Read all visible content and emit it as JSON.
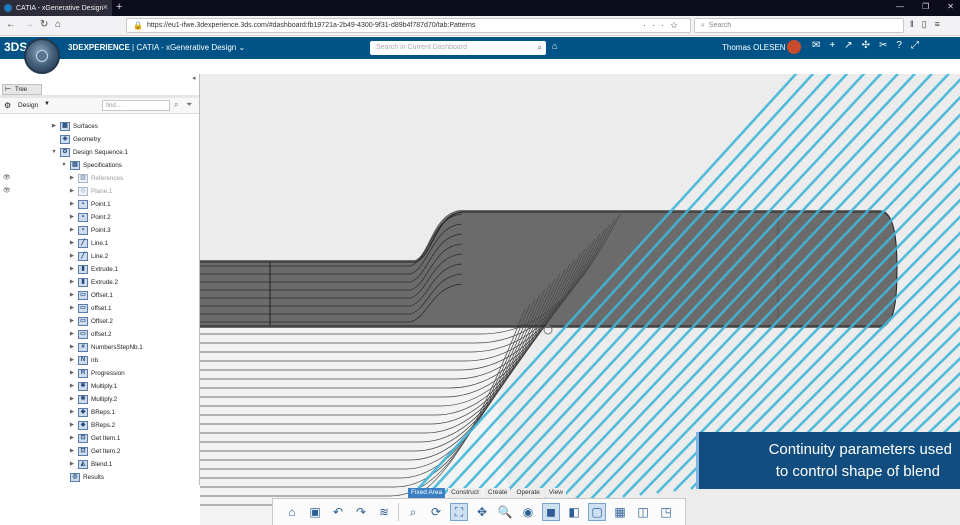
{
  "browser": {
    "tab_title": "CATIA - xGenerative Design",
    "new_tab": "+",
    "url": "https://eu1-ifwe.3dexperience.3ds.com/#dashboard:fb19721a-2b49-4300-9f31-d89b4f787d70/tab:Patterns",
    "search_placeholder": "Search",
    "window_controls": [
      "—",
      "❐",
      "✕"
    ]
  },
  "app": {
    "logo": "3DS",
    "brand_bold": "3DEXPERIENCE",
    "brand_sep": " | ",
    "app_name": "CATIA - xGenerative Design",
    "search_placeholder": "Search in Current Dashboard",
    "user_name": "Thomas OLESEN",
    "colors": {
      "bar": "#005386",
      "accent_lines": "#40b6d8",
      "caption_bg": "#114d7e"
    }
  },
  "panel": {
    "tab_label": "Tree",
    "design_label": "Design",
    "find_placeholder": "find...",
    "tree": [
      {
        "label": "Surfaces",
        "depth": 1,
        "twisty": "▶",
        "icon": "▦"
      },
      {
        "label": "Geometry",
        "depth": 1,
        "twisty": "",
        "icon": "◈"
      },
      {
        "label": "Design Sequence.1",
        "depth": 1,
        "twisty": "▼",
        "icon": "⚙"
      },
      {
        "label": "Specifications",
        "depth": 2,
        "twisty": "▼",
        "icon": "▤"
      },
      {
        "label": "References",
        "depth": 3,
        "twisty": "▶",
        "icon": "▥",
        "dim": true,
        "eye": true
      },
      {
        "label": "Plane.1",
        "depth": 3,
        "twisty": "▶",
        "icon": "◇",
        "dim": true,
        "eye": true
      },
      {
        "label": "Point.1",
        "depth": 3,
        "twisty": "▶",
        "icon": "•"
      },
      {
        "label": "Point.2",
        "depth": 3,
        "twisty": "▶",
        "icon": "•"
      },
      {
        "label": "Point.3",
        "depth": 3,
        "twisty": "▶",
        "icon": "•"
      },
      {
        "label": "Line.1",
        "depth": 3,
        "twisty": "▶",
        "icon": "╱"
      },
      {
        "label": "Line.2",
        "depth": 3,
        "twisty": "▶",
        "icon": "╱"
      },
      {
        "label": "Extrude.1",
        "depth": 3,
        "twisty": "▶",
        "icon": "▮"
      },
      {
        "label": "Extrude.2",
        "depth": 3,
        "twisty": "▶",
        "icon": "▮"
      },
      {
        "label": "Offset.1",
        "depth": 3,
        "twisty": "▶",
        "icon": "▭"
      },
      {
        "label": "offset.1",
        "depth": 3,
        "twisty": "▶",
        "icon": "▭"
      },
      {
        "label": "Offset.2",
        "depth": 3,
        "twisty": "▶",
        "icon": "▭"
      },
      {
        "label": "offset.2",
        "depth": 3,
        "twisty": "▶",
        "icon": "▭"
      },
      {
        "label": "NumbersStepNb.1",
        "depth": 3,
        "twisty": "▶",
        "icon": "#"
      },
      {
        "label": "nb",
        "depth": 3,
        "twisty": "▶",
        "icon": "N"
      },
      {
        "label": "Progression",
        "depth": 3,
        "twisty": "▶",
        "icon": "R"
      },
      {
        "label": "Multiply.1",
        "depth": 3,
        "twisty": "▶",
        "icon": "✱"
      },
      {
        "label": "Multiply.2",
        "depth": 3,
        "twisty": "▶",
        "icon": "✱"
      },
      {
        "label": "BReps.1",
        "depth": 3,
        "twisty": "▶",
        "icon": "◆"
      },
      {
        "label": "BReps.2",
        "depth": 3,
        "twisty": "▶",
        "icon": "◆"
      },
      {
        "label": "Get Item.1",
        "depth": 3,
        "twisty": "▶",
        "icon": "⊡"
      },
      {
        "label": "Get Item.2",
        "depth": 3,
        "twisty": "▶",
        "icon": "⊡"
      },
      {
        "label": "Blend.1",
        "depth": 3,
        "twisty": "▶",
        "icon": "◭"
      },
      {
        "label": "Results",
        "depth": 2,
        "twisty": "",
        "icon": "◎"
      }
    ]
  },
  "toolbar": {
    "tabs": [
      {
        "label": "Fixed Area",
        "active": true
      },
      {
        "label": "Construct",
        "active": false
      },
      {
        "label": "Create",
        "active": false
      },
      {
        "label": "Operate",
        "active": false
      },
      {
        "label": "View",
        "active": false
      }
    ],
    "buttons": [
      {
        "name": "home-icon",
        "glyph": "⌂"
      },
      {
        "name": "save-icon",
        "glyph": "▣"
      },
      {
        "name": "undo-icon",
        "glyph": "↶"
      },
      {
        "name": "redo-icon",
        "glyph": "↷"
      },
      {
        "name": "share-icon",
        "glyph": "≋"
      },
      {
        "name": "sep"
      },
      {
        "name": "measure-icon",
        "glyph": "⌕"
      },
      {
        "name": "rotate-icon",
        "glyph": "⟳"
      },
      {
        "name": "fit-all-icon",
        "glyph": "⛶",
        "selected": true
      },
      {
        "name": "pan-icon",
        "glyph": "✥"
      },
      {
        "name": "zoom-icon",
        "glyph": "🔍"
      },
      {
        "name": "normal-view-icon",
        "glyph": "◉"
      },
      {
        "name": "iso-view-icon",
        "glyph": "◼",
        "selected": true
      },
      {
        "name": "shading-icon",
        "glyph": "◧"
      },
      {
        "name": "render-icon",
        "glyph": "▢",
        "selected": true
      },
      {
        "name": "grid-icon",
        "glyph": "▦"
      },
      {
        "name": "hide-show-icon",
        "glyph": "◫"
      },
      {
        "name": "cube-icon",
        "glyph": "◳"
      }
    ]
  },
  "caption": {
    "line1": "Continuity parameters used",
    "line2": "to control shape of blend"
  }
}
